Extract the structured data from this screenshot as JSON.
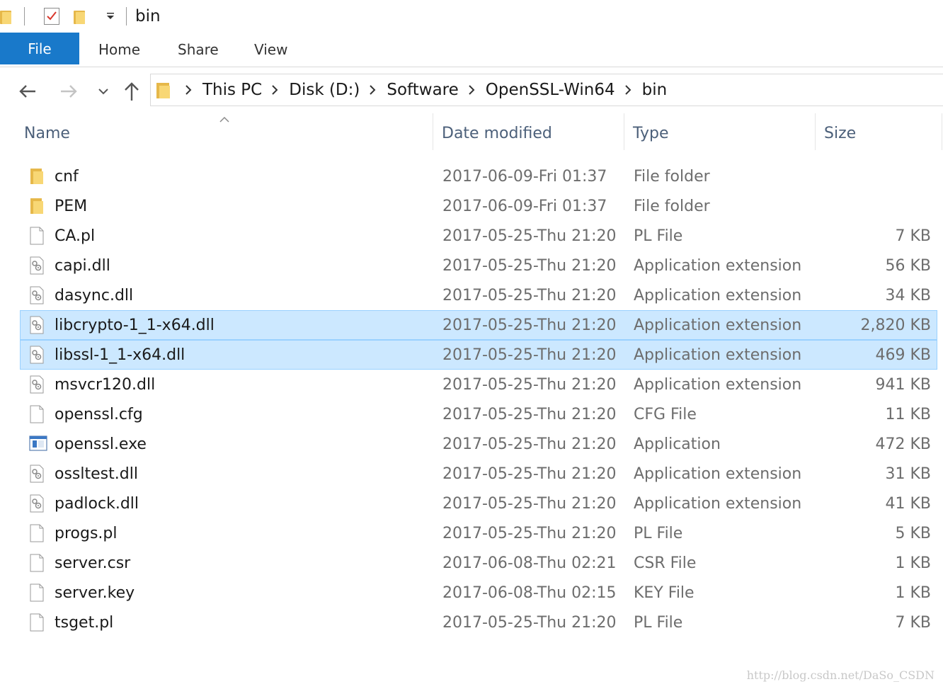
{
  "window": {
    "title": "bin"
  },
  "ribbon": {
    "tabs": [
      {
        "label": "File",
        "active": true
      },
      {
        "label": "Home"
      },
      {
        "label": "Share"
      },
      {
        "label": "View"
      }
    ]
  },
  "address_bar": {
    "crumbs": [
      "This PC",
      "Disk (D:)",
      "Software",
      "OpenSSL-Win64",
      "bin"
    ]
  },
  "columns": {
    "name": "Name",
    "date": "Date modified",
    "type": "Type",
    "size": "Size"
  },
  "files": [
    {
      "name": "cnf",
      "date": "2017-06-09-Fri 01:37",
      "type": "File folder",
      "size": "",
      "icon": "folder-icon"
    },
    {
      "name": "PEM",
      "date": "2017-06-09-Fri 01:37",
      "type": "File folder",
      "size": "",
      "icon": "folder-icon"
    },
    {
      "name": "CA.pl",
      "date": "2017-05-25-Thu 21:20",
      "type": "PL File",
      "size": "7 KB",
      "icon": "file-icon"
    },
    {
      "name": "capi.dll",
      "date": "2017-05-25-Thu 21:20",
      "type": "Application extension",
      "size": "56 KB",
      "icon": "dll-icon"
    },
    {
      "name": "dasync.dll",
      "date": "2017-05-25-Thu 21:20",
      "type": "Application extension",
      "size": "34 KB",
      "icon": "dll-icon"
    },
    {
      "name": "libcrypto-1_1-x64.dll",
      "date": "2017-05-25-Thu 21:20",
      "type": "Application extension",
      "size": "2,820 KB",
      "icon": "dll-icon",
      "selected": true
    },
    {
      "name": "libssl-1_1-x64.dll",
      "date": "2017-05-25-Thu 21:20",
      "type": "Application extension",
      "size": "469 KB",
      "icon": "dll-icon",
      "selected": true
    },
    {
      "name": "msvcr120.dll",
      "date": "2017-05-25-Thu 21:20",
      "type": "Application extension",
      "size": "941 KB",
      "icon": "dll-icon"
    },
    {
      "name": "openssl.cfg",
      "date": "2017-05-25-Thu 21:20",
      "type": "CFG File",
      "size": "11 KB",
      "icon": "file-icon"
    },
    {
      "name": "openssl.exe",
      "date": "2017-05-25-Thu 21:20",
      "type": "Application",
      "size": "472 KB",
      "icon": "exe-icon"
    },
    {
      "name": "ossltest.dll",
      "date": "2017-05-25-Thu 21:20",
      "type": "Application extension",
      "size": "31 KB",
      "icon": "dll-icon"
    },
    {
      "name": "padlock.dll",
      "date": "2017-05-25-Thu 21:20",
      "type": "Application extension",
      "size": "41 KB",
      "icon": "dll-icon"
    },
    {
      "name": "progs.pl",
      "date": "2017-05-25-Thu 21:20",
      "type": "PL File",
      "size": "5 KB",
      "icon": "file-icon"
    },
    {
      "name": "server.csr",
      "date": "2017-06-08-Thu 02:21",
      "type": "CSR File",
      "size": "1 KB",
      "icon": "file-icon"
    },
    {
      "name": "server.key",
      "date": "2017-06-08-Thu 02:15",
      "type": "KEY File",
      "size": "1 KB",
      "icon": "file-icon"
    },
    {
      "name": "tsget.pl",
      "date": "2017-05-25-Thu 21:20",
      "type": "PL File",
      "size": "7 KB",
      "icon": "file-icon"
    }
  ],
  "watermark": "http://blog.csdn.net/DaSo_CSDN",
  "colors": {
    "accent": "#1979ca",
    "selected_bg": "#cce8ff",
    "selected_border": "#99d1ff",
    "folder": "#f8d775"
  }
}
